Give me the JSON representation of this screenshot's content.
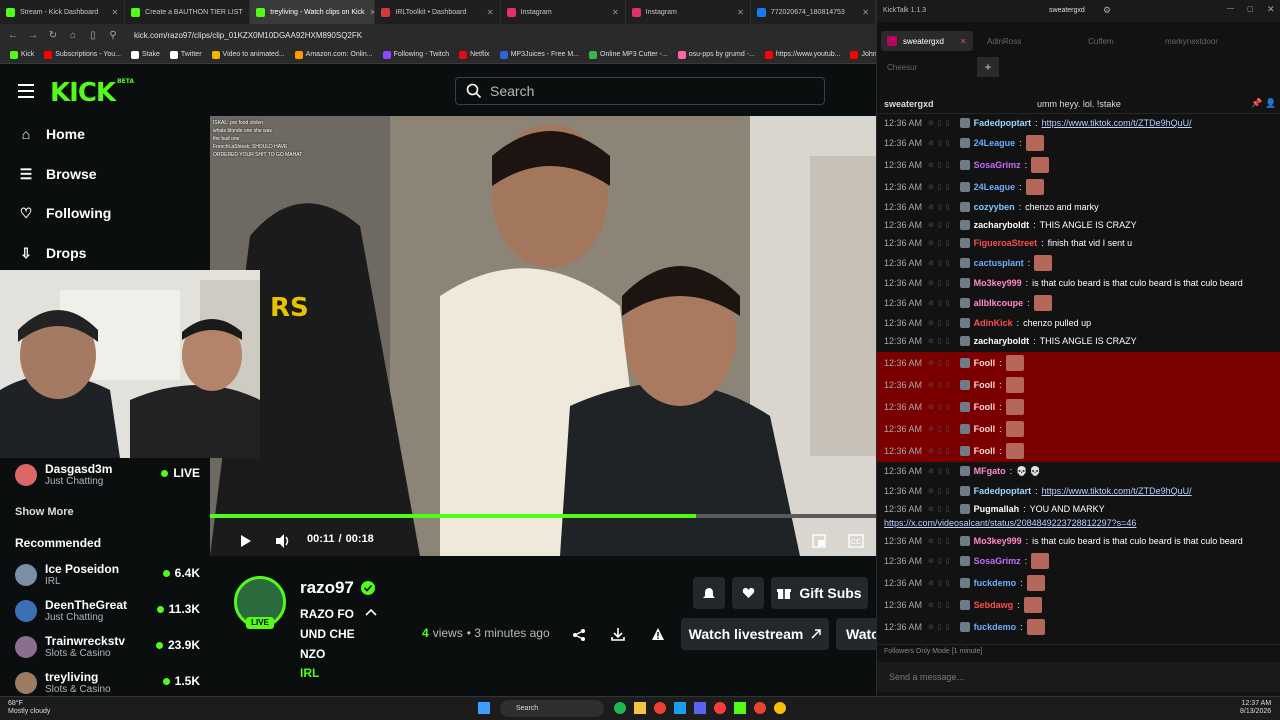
{
  "browser": {
    "tabs": [
      {
        "label": "Stream - Kick Dashboard",
        "color": "#53fc18"
      },
      {
        "label": "Create a BAUTHON TIER LIST",
        "color": "#53fc18"
      },
      {
        "label": "treyliving - Watch clips on Kick",
        "color": "#53fc18"
      },
      {
        "label": "IRLToolkit • Dashboard",
        "color": "#d23a3a"
      },
      {
        "label": "Instagram",
        "color": "#e1306c"
      },
      {
        "label": "Instagram",
        "color": "#e1306c"
      },
      {
        "label": "772020674_180814753",
        "color": "#1877f2"
      }
    ],
    "url": "kick.com/razo97/clips/clip_01KZX0M10DGAA92HXM890SQ2FK",
    "bookmarks": [
      {
        "label": "Kick",
        "color": "#53fc18"
      },
      {
        "label": "Subscriptions - You...",
        "color": "#ff0000"
      },
      {
        "label": "Stake",
        "color": "#ffffff"
      },
      {
        "label": "Twitter",
        "color": "#ffffff"
      },
      {
        "label": "Video to animated...",
        "color": "#f5b400"
      },
      {
        "label": "Amazon.com: Onlin...",
        "color": "#ff9900"
      },
      {
        "label": "Following - Twitch",
        "color": "#9146ff"
      },
      {
        "label": "Netflix",
        "color": "#e50914"
      },
      {
        "label": "MP3Juices - Free M...",
        "color": "#2b66d9"
      },
      {
        "label": "Online MP3 Cutter -...",
        "color": "#3ab54a"
      },
      {
        "label": "osu-pps by grumd -...",
        "color": "#ff66aa"
      },
      {
        "label": "https://www.youtub...",
        "color": "#ff0000"
      },
      {
        "label": "John",
        "color": "#ff0000"
      }
    ]
  },
  "kick": {
    "logo": "KICK",
    "logo_super": "BETA",
    "search_placeholder": "Search",
    "nav": [
      {
        "label": "Home",
        "icon": "home-icon"
      },
      {
        "label": "Browse",
        "icon": "browse-icon"
      },
      {
        "label": "Following",
        "icon": "heart-icon"
      },
      {
        "label": "Drops",
        "icon": "drops-icon"
      }
    ],
    "following_stream": {
      "name": "Dasgasd3m",
      "category": "Just Chatting",
      "status": "LIVE"
    },
    "show_more": "Show More",
    "recommended_title": "Recommended",
    "recommended": [
      {
        "name": "Ice Poseidon",
        "category": "IRL",
        "viewers": "6.4K"
      },
      {
        "name": "DeenTheGreat",
        "category": "Just Chatting",
        "viewers": "11.3K"
      },
      {
        "name": "Trainwreckstv",
        "category": "Slots & Casino",
        "viewers": "23.9K"
      },
      {
        "name": "treyliving",
        "category": "Slots & Casino",
        "viewers": "1.5K"
      }
    ],
    "video": {
      "current_time": "00:11",
      "separator": "/",
      "duration": "00:18",
      "progress": 0.73,
      "chat_overlay": [
        "ISKAL: pre food stolen",
        "whats blonde one she was",
        "the bad one",
        "FrenchLaShiesk: SHOULD HAVE",
        "ORDERED YOUR SHIT TO GO MAHAT"
      ]
    },
    "clip": {
      "channel": "razo97",
      "title_lines": [
        "RAZO FO",
        "UND CHE",
        "NZO"
      ],
      "category": "IRL",
      "views_count": "4",
      "views_label": "views",
      "time_ago": "• 3 minutes ago",
      "live_badge": "LIVE",
      "gift_subs": "Gift Subs",
      "watch_livestream": "Watch livestream",
      "watch_cut": "Watc"
    }
  },
  "kicktalk": {
    "app_title": "KickTalk 1.1.3",
    "window_user": "sweatergxd",
    "tabs": [
      {
        "label": "sweatergxd",
        "active": true
      },
      {
        "label": "AdinRoss",
        "active": false
      },
      {
        "label": "Cuffem",
        "active": false
      },
      {
        "label": "markynextdoor",
        "active": false
      },
      {
        "label": "Cheesur",
        "active": false
      }
    ],
    "channel": "sweatergxd",
    "pinned": "umm heyy. lol. !stake",
    "messages": [
      {
        "time": "12:36 AM",
        "user": "Fadedpoptart",
        "color": "#9ad7ff",
        "text": "https://www.tiktok.com/t/ZTDe9hQuU/",
        "link": true
      },
      {
        "time": "12:36 AM",
        "user": "24League",
        "color": "#6ab0ff",
        "text": "",
        "emote": true
      },
      {
        "time": "12:36 AM",
        "user": "SosaGrimz",
        "color": "#c36bff",
        "text": "",
        "emote": true
      },
      {
        "time": "12:36 AM",
        "user": "24League",
        "color": "#6ab0ff",
        "text": "",
        "emote": true
      },
      {
        "time": "12:36 AM",
        "user": "cozyyben",
        "color": "#7ec8ff",
        "text": "chenzo and marky"
      },
      {
        "time": "12:36 AM",
        "user": "zacharyboldt",
        "color": "#ffffff",
        "text": "THIS ANGLE IS CRAZY"
      },
      {
        "time": "12:36 AM",
        "user": "FigueroaStreet",
        "color": "#ff4d4d",
        "text": "finish that vid I sent u"
      },
      {
        "time": "12:36 AM",
        "user": "cactusplant",
        "color": "#6ab0ff",
        "text": "",
        "emote": true
      },
      {
        "time": "12:36 AM",
        "user": "Mo3key999",
        "color": "#ff8ac8",
        "text": "is that culo beard is that culo beard is that culo beard"
      },
      {
        "time": "12:36 AM",
        "user": "allblkcoupe",
        "color": "#ff8ac8",
        "text": "",
        "emote": true
      },
      {
        "time": "12:36 AM",
        "user": "AdinKick",
        "color": "#ff4d4d",
        "text": "chenzo pulled up"
      },
      {
        "time": "12:36 AM",
        "user": "zacharyboldt",
        "color": "#ffffff",
        "text": "THIS ANGLE IS CRAZY"
      },
      {
        "time": "12:36 AM",
        "user": "Fooll",
        "color": "#ffd6d6",
        "text": "",
        "emote": true,
        "hl": true
      },
      {
        "time": "12:36 AM",
        "user": "Fooll",
        "color": "#ffd6d6",
        "text": "",
        "emote": true,
        "hl": true
      },
      {
        "time": "12:36 AM",
        "user": "Fooll",
        "color": "#ffd6d6",
        "text": "",
        "emote": true,
        "hl": true
      },
      {
        "time": "12:36 AM",
        "user": "Fooll",
        "color": "#ffd6d6",
        "text": "",
        "emote": true,
        "hl": true
      },
      {
        "time": "12:36 AM",
        "user": "Fooll",
        "color": "#ffd6d6",
        "text": "",
        "emote": true,
        "hl": true
      },
      {
        "time": "12:36 AM",
        "user": "MFgato",
        "color": "#ff8ac8",
        "text": "💀 💀"
      },
      {
        "time": "12:36 AM",
        "user": "Fadedpoptart",
        "color": "#9ad7ff",
        "text": "https://www.tiktok.com/t/ZTDe9hQuU/",
        "link": true
      },
      {
        "time": "12:36 AM",
        "user": "Pugmallah",
        "color": "#ffffff",
        "text": "YOU AND MARKY"
      },
      {
        "time": "",
        "user": "",
        "color": "#ffffff",
        "text": "https://x.com/videosalcant/status/2084849223728812297?s=46",
        "link": true
      },
      {
        "time": "12:36 AM",
        "user": "Mo3key999",
        "color": "#ff8ac8",
        "text": "is that culo beard is that culo beard is that culo beard"
      },
      {
        "time": "12:36 AM",
        "user": "SosaGrimz",
        "color": "#c36bff",
        "text": "",
        "emote": true
      },
      {
        "time": "12:36 AM",
        "user": "fuckdemo",
        "color": "#6ab0ff",
        "text": "",
        "emote": true
      },
      {
        "time": "12:36 AM",
        "user": "Sebdawg",
        "color": "#ff4d4d",
        "text": "",
        "emote": true
      },
      {
        "time": "12:36 AM",
        "user": "fuckdemo",
        "color": "#6ab0ff",
        "text": "",
        "emote": true
      }
    ],
    "followers_mode": "Followers Only Mode [1 minute]",
    "send_placeholder": "Send a message..."
  },
  "taskbar": {
    "weather_temp": "68°F",
    "weather_desc": "Mostly cloudy",
    "search": "Search",
    "time": "12:37 AM",
    "date": "8/13/2026"
  }
}
